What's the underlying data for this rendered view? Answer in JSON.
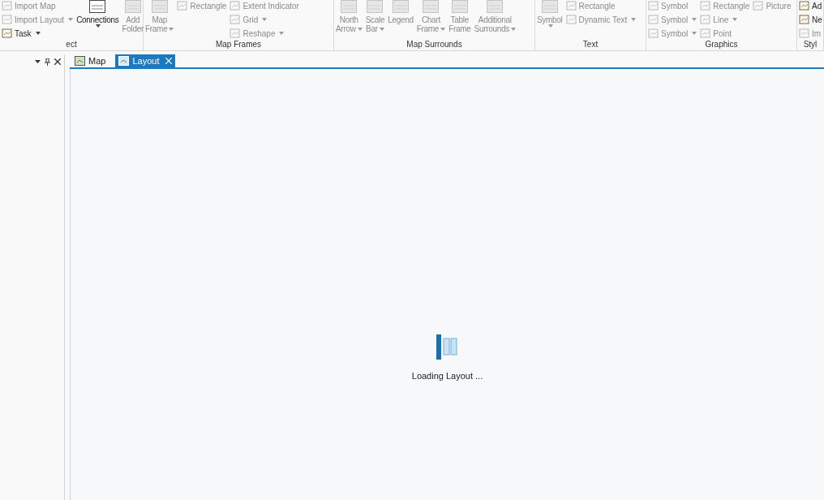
{
  "ribbon": {
    "groups": [
      {
        "label": "ect",
        "columns": [
          {
            "kind": "stack",
            "items": [
              {
                "label": "Import Map",
                "caret": false,
                "disabled": true
              },
              {
                "label": "Import Layout",
                "caret": true,
                "disabled": true
              },
              {
                "label": "Task",
                "caret": true,
                "disabled": false
              }
            ]
          },
          {
            "kind": "large",
            "label": "Connections",
            "caret": true,
            "disabled": false
          },
          {
            "kind": "large",
            "label": "Add\nFolder",
            "caret": false,
            "disabled": true
          }
        ]
      },
      {
        "label": "Map Frames",
        "columns": [
          {
            "kind": "large",
            "label": "Map\nFrame",
            "caret": true,
            "disabled": true
          },
          {
            "kind": "stack",
            "items": [
              {
                "label": "Rectangle",
                "caret": false,
                "disabled": true
              }
            ]
          },
          {
            "kind": "stack",
            "items": [
              {
                "label": "Extent Indicator",
                "caret": false,
                "disabled": true
              },
              {
                "label": "Grid",
                "caret": true,
                "disabled": true
              },
              {
                "label": "Reshape",
                "caret": true,
                "disabled": true
              }
            ]
          }
        ]
      },
      {
        "label": "Map Surrounds",
        "columns": [
          {
            "kind": "large",
            "label": "North\nArrow",
            "caret": true,
            "disabled": true
          },
          {
            "kind": "large",
            "label": "Scale\nBar",
            "caret": true,
            "disabled": true
          },
          {
            "kind": "large",
            "label": "Legend",
            "caret": false,
            "disabled": true
          },
          {
            "kind": "large",
            "label": "Chart\nFrame",
            "caret": true,
            "disabled": true
          },
          {
            "kind": "large",
            "label": "Table\nFrame",
            "caret": false,
            "disabled": true
          },
          {
            "kind": "large",
            "label": "Additional\nSurrounds",
            "caret": true,
            "disabled": true
          }
        ]
      },
      {
        "label": "Text",
        "columns": [
          {
            "kind": "large",
            "label": "Symbol",
            "caret": true,
            "disabled": true
          },
          {
            "kind": "stack",
            "items": [
              {
                "label": "Rectangle",
                "caret": false,
                "disabled": true
              },
              {
                "label": "Dynamic Text",
                "caret": true,
                "disabled": true
              }
            ]
          }
        ]
      },
      {
        "label": "Graphics",
        "columns": [
          {
            "kind": "stack",
            "items": [
              {
                "label": "Symbol",
                "caret": false,
                "disabled": true
              },
              {
                "label": "Symbol",
                "caret": true,
                "disabled": true
              },
              {
                "label": "Symbol",
                "caret": true,
                "disabled": true
              }
            ]
          },
          {
            "kind": "stack",
            "items": [
              {
                "label": "Rectangle",
                "caret": false,
                "disabled": true
              },
              {
                "label": "Line",
                "caret": true,
                "disabled": true
              },
              {
                "label": "Point",
                "caret": false,
                "disabled": true
              }
            ]
          },
          {
            "kind": "stack",
            "items": [
              {
                "label": "Picture",
                "caret": false,
                "disabled": true
              }
            ]
          }
        ]
      },
      {
        "label": "Styl",
        "columns": [
          {
            "kind": "stack",
            "items": [
              {
                "label": "Ad",
                "caret": false,
                "disabled": false
              },
              {
                "label": "Ne",
                "caret": false,
                "disabled": false
              },
              {
                "label": "Im",
                "caret": false,
                "disabled": true
              }
            ]
          }
        ]
      }
    ]
  },
  "tabs": [
    {
      "label": "Map",
      "selected": false,
      "closable": false
    },
    {
      "label": "Layout",
      "selected": true,
      "closable": true
    }
  ],
  "loading": {
    "text": "Loading Layout ..."
  }
}
